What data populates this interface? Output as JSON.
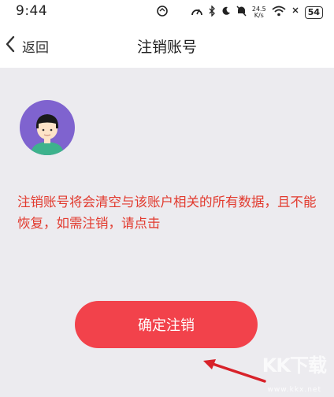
{
  "status_bar": {
    "time": "9:44",
    "net_speed_value": "24.5",
    "net_speed_unit": "K/s",
    "battery": "54"
  },
  "nav": {
    "back_label": "返回",
    "title": "注销账号"
  },
  "main": {
    "warning_text": "注销账号将会清空与该账户相关的所有数据，且不能恢复，如需注销，请点击",
    "confirm_button": "确定注销"
  },
  "watermark": {
    "logo": "KK下载",
    "url": "www.kkx.net"
  },
  "colors": {
    "accent": "#f2424b",
    "warning_text": "#e23a2e",
    "background": "#ecebef"
  }
}
